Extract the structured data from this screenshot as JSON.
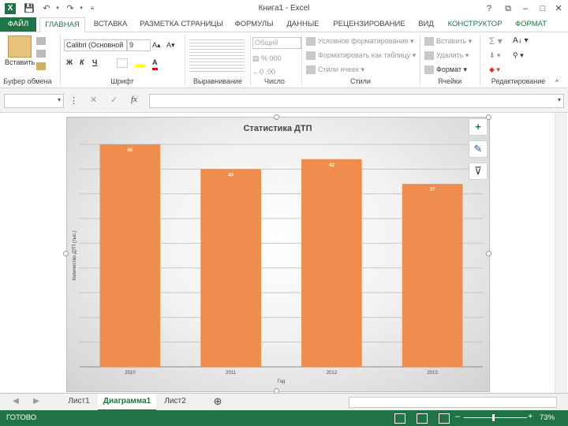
{
  "window": {
    "title": "Книга1 - Excel",
    "help": "?",
    "restore": "⧉",
    "minimize": "–",
    "maximize": "□",
    "close": "✕",
    "logo": "X"
  },
  "tabs": [
    "ФАЙЛ",
    "ГЛАВНАЯ",
    "ВСТАВКА",
    "РАЗМЕТКА СТРАНИЦЫ",
    "ФОРМУЛЫ",
    "ДАННЫЕ",
    "РЕЦЕНЗИРОВАНИЕ",
    "ВИД",
    "КОНСТРУКТОР",
    "ФОРМАТ"
  ],
  "ribbon": {
    "paste": "Вставить",
    "font_name": "Calibri (Основной",
    "font_size": "9",
    "bold": "Ж",
    "italic": "К",
    "underline": "Ч",
    "number_format": "Общий",
    "conditional": "Условное форматирование",
    "format_table": "Форматировать как таблицу",
    "cell_styles": "Стили ячеек",
    "insert": "Вставить",
    "delete": "Удалить",
    "format": "Формат",
    "groups": {
      "clipboard": "Буфер обмена",
      "font": "Шрифт",
      "alignment": "Выравнивание",
      "number": "Число",
      "styles": "Стили",
      "cells": "Ячейки",
      "editing": "Редактирование"
    }
  },
  "formula_bar": {
    "name_value": "",
    "fx": "fx",
    "cancel": "✕",
    "enter": "✓",
    "formula_value": ""
  },
  "sheets": [
    "Лист1",
    "Диаграмма1",
    "Лист2"
  ],
  "status": {
    "ready": "ГОТОВО",
    "zoom": "73%",
    "zoom_minus": "–",
    "zoom_plus": "+"
  },
  "colors": {
    "excel_green": "#217346",
    "bar": "#ee8d4d"
  },
  "chart_data": {
    "type": "bar",
    "title": "Статистика ДТП",
    "xlabel": "Год",
    "ylabel": "Количество ДТП (тыс.)",
    "categories": [
      "2010",
      "2011",
      "2012",
      "2013"
    ],
    "values": [
      45,
      40,
      42,
      37
    ],
    "ylim": [
      0,
      45
    ],
    "grid": true,
    "legend": "none"
  }
}
